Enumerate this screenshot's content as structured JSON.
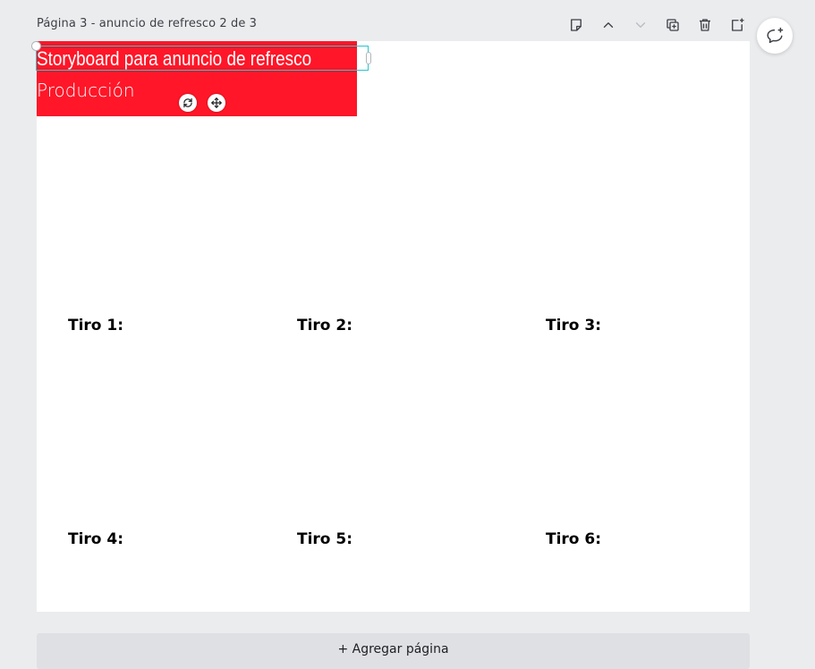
{
  "header": {
    "page_title": "Página 3 - anuncio de refresco 2 de 3"
  },
  "toolbar": {
    "icons": [
      "sticky-note-icon",
      "chevron-up-icon",
      "chevron-down-icon",
      "duplicate-icon",
      "trash-icon",
      "add-page-icon"
    ]
  },
  "comment": {
    "icon": "add-comment-icon"
  },
  "banner": {
    "title": "Storyboard para anuncio de refresco",
    "subtitle": "Producción",
    "color": "#ff1628"
  },
  "selection": {
    "color": "#26c6d0"
  },
  "shots": [
    {
      "label": "Tiro 1:"
    },
    {
      "label": "Tiro 2:"
    },
    {
      "label": "Tiro 3:"
    },
    {
      "label": "Tiro 4:"
    },
    {
      "label": "Tiro 5:"
    },
    {
      "label": "Tiro 6:"
    }
  ],
  "footer": {
    "add_page_label": "+ Agregar página"
  }
}
